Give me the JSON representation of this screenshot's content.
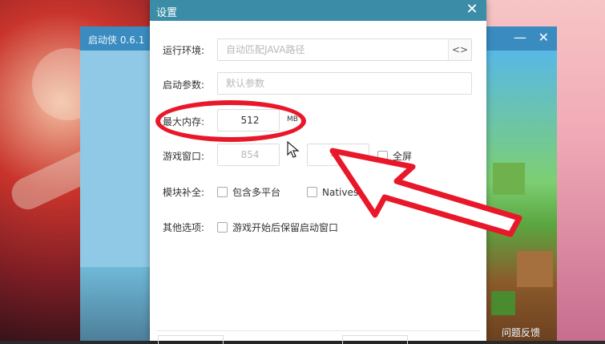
{
  "launcher": {
    "title": "启动侠 0.6.1",
    "minimize_glyph": "—",
    "close_glyph": "✕",
    "feedback_label": "问题反馈"
  },
  "dialog": {
    "title": "设置",
    "close_glyph": "✕",
    "java_env": {
      "label": "运行环境:",
      "placeholder": "自动匹配JAVA路径",
      "browse_glyph": "<>"
    },
    "launch_args": {
      "label": "启动参数:",
      "placeholder": "默认参数"
    },
    "max_memory": {
      "label": "最大内存:",
      "value": "512",
      "unit": "MB"
    },
    "game_window": {
      "label": "游戏窗口:",
      "width_placeholder": "854",
      "height_placeholder": "480",
      "fullscreen_label": "全屏"
    },
    "module_complete": {
      "label": "模块补全:",
      "multi_platform_label": "包含多平台",
      "natives_label": "Natives使用临时目录"
    },
    "other_options": {
      "label": "其他选项:",
      "keep_window_label": "游戏开始后保留启动窗口"
    }
  },
  "colors": {
    "dialog_titlebar": "#3a8ca7",
    "annotation_red": "#e8182a"
  }
}
